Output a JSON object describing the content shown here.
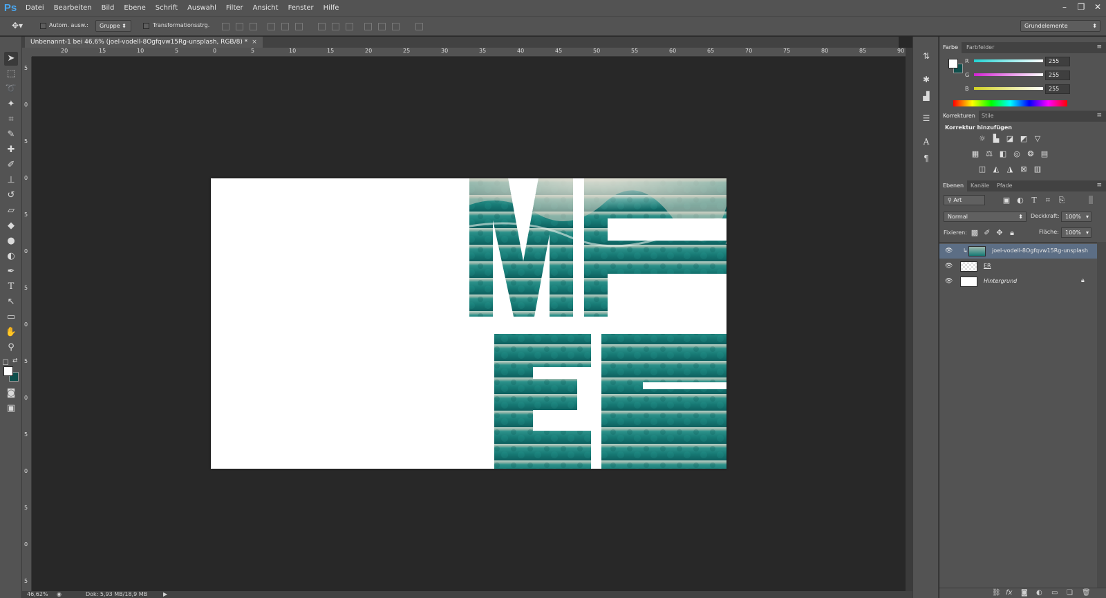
{
  "app": {
    "logo": "Ps"
  },
  "menu": [
    "Datei",
    "Bearbeiten",
    "Bild",
    "Ebene",
    "Schrift",
    "Auswahl",
    "Filter",
    "Ansicht",
    "Fenster",
    "Hilfe"
  ],
  "window_controls": {
    "minimize": "–",
    "restore": "❐",
    "close": "✕"
  },
  "options": {
    "auto_select_label": "Autom. ausw.:",
    "auto_select_target": "Gruppe",
    "transform_label": "Transformationsstrg.",
    "workspace": "Grundelemente"
  },
  "document_tab": {
    "title": "Unbenannt-1 bei 46,6% (joel-vodell-8Ogfqvw15Rg-unsplash, RGB/8) *",
    "close": "×"
  },
  "ruler_top_labels": [
    "20",
    "15",
    "10",
    "5",
    "0",
    "5",
    "10",
    "15",
    "20",
    "25",
    "30",
    "35",
    "40",
    "45",
    "50",
    "55",
    "60",
    "65",
    "70",
    "75",
    "80",
    "85",
    "90"
  ],
  "ruler_left_labels": [
    "5",
    "0",
    "5",
    "0",
    "5",
    "0",
    "5",
    "0",
    "5",
    "0",
    "5",
    "0",
    "5",
    "0",
    "5"
  ],
  "canvas_text": {
    "line1": "ME",
    "line2": "ER"
  },
  "status": {
    "zoom": "46,62%",
    "doc_info": "Dok: 5,93 MB/18,9 MB"
  },
  "color_panel": {
    "tabs": [
      "Farbe",
      "Farbfelder"
    ],
    "channels": [
      {
        "label": "R",
        "value": "255",
        "color": "#22d3d3"
      },
      {
        "label": "G",
        "value": "255",
        "color": "#d322d3"
      },
      {
        "label": "B",
        "value": "255",
        "color": "#d3d322"
      }
    ]
  },
  "adjustments_panel": {
    "tabs": [
      "Korrekturen",
      "Stile"
    ],
    "heading": "Korrektur hinzufügen",
    "row1": [
      "sun-icon",
      "levels-icon",
      "curves-icon",
      "exposure-icon",
      "vibrance-icon"
    ],
    "row2": [
      "hue-icon",
      "balance-icon",
      "bw-icon",
      "photo-filter-icon",
      "mixer-icon",
      "lookup-icon"
    ],
    "row3": [
      "invert-icon",
      "posterize-icon",
      "threshold-icon",
      "selective-color-icon",
      "gradient-map-icon"
    ]
  },
  "layers_panel": {
    "tabs": [
      "Ebenen",
      "Kanäle",
      "Pfade"
    ],
    "filter": "Art",
    "blend_mode": "Normal",
    "opacity_label": "Deckkraft:",
    "opacity": "100%",
    "lock_label": "Fixieren:",
    "fill_label": "Fläche:",
    "fill": "100%",
    "layers": [
      {
        "name": "joel-vodell-8Ogfqvw15Rg-unsplash",
        "selected": true,
        "italic": false
      },
      {
        "name": "ER",
        "selected": false,
        "italic": false
      },
      {
        "name": "Hintergrund",
        "selected": false,
        "italic": true
      }
    ]
  },
  "colors": {
    "accent": "#4aa7f0",
    "selection": "#5c6e85",
    "sea_dark": "#0f6b6a",
    "sea_mid": "#1f8a84",
    "foam": "#cfe3dc"
  }
}
